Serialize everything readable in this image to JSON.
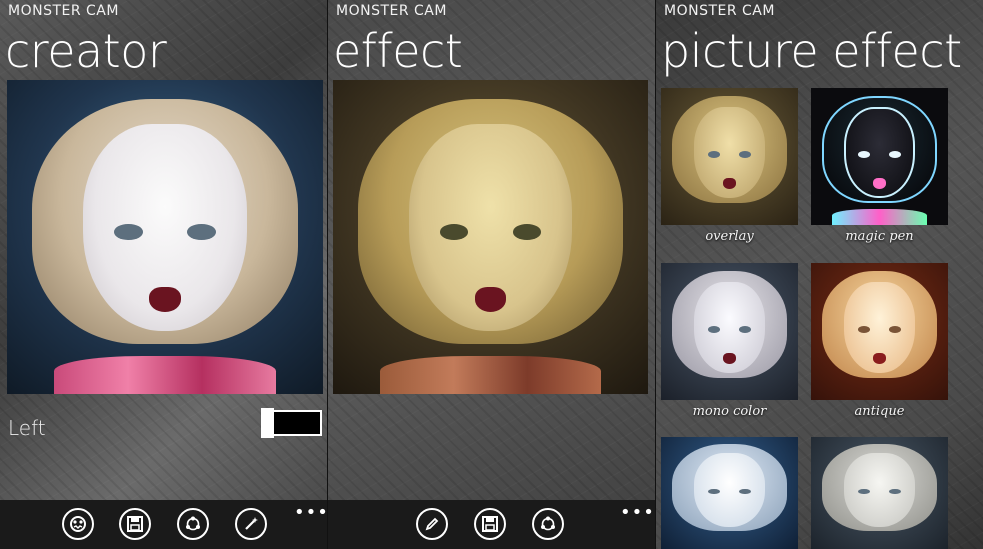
{
  "screens": [
    {
      "app_title": "MONSTER CAM",
      "page_title": "creator",
      "toggle_label": "Left",
      "toggle_state": "off",
      "appbar_buttons": [
        "monster-face-icon",
        "save-icon",
        "share-icon",
        "magic-wand-icon"
      ],
      "more": "•••"
    },
    {
      "app_title": "MONSTER CAM",
      "page_title": "effect",
      "appbar_buttons": [
        "pencil-icon",
        "save-icon",
        "share-icon"
      ],
      "more": "•••"
    },
    {
      "app_title": "MONSTER CAM",
      "page_title": "picture effect",
      "effects": [
        "overlay",
        "magic pen",
        "mono color",
        "antique"
      ]
    }
  ]
}
